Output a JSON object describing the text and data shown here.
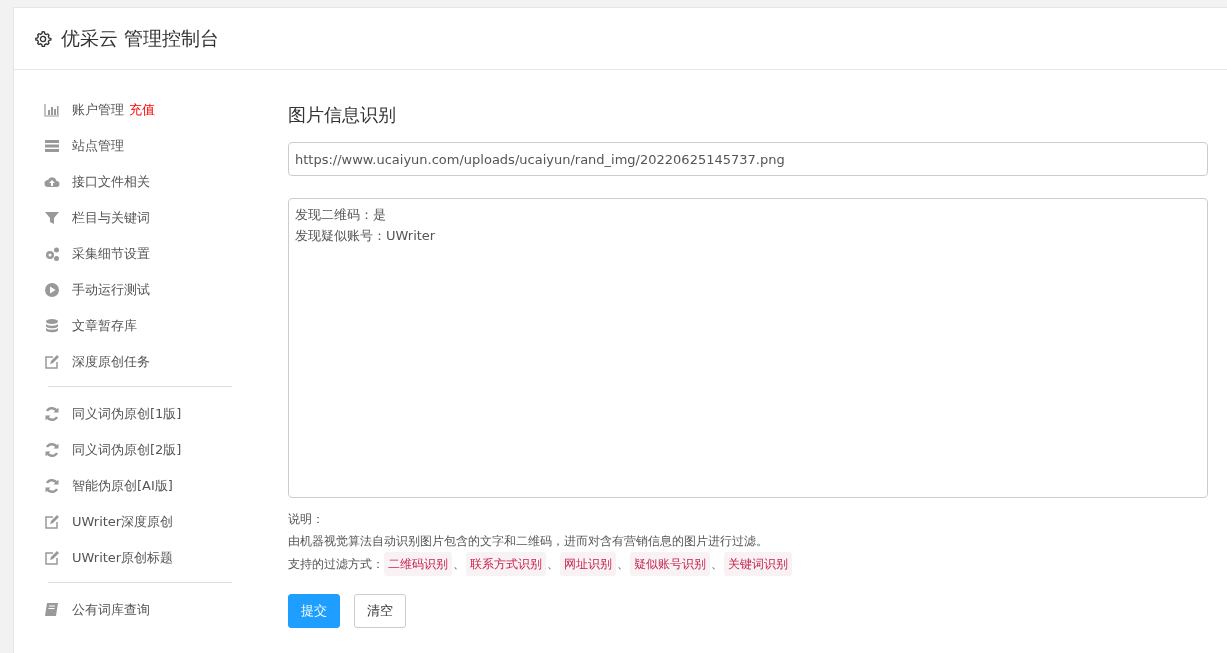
{
  "header": {
    "title": "优采云 管理控制台"
  },
  "sidebar": {
    "groups": [
      {
        "items": [
          {
            "label": "账户管理",
            "badge": "充值"
          },
          {
            "label": "站点管理"
          },
          {
            "label": "接口文件相关"
          },
          {
            "label": "栏目与关键词"
          },
          {
            "label": "采集细节设置"
          },
          {
            "label": "手动运行测试"
          },
          {
            "label": "文章暂存库"
          },
          {
            "label": "深度原创任务"
          }
        ]
      },
      {
        "items": [
          {
            "label": "同义词伪原创[1版]"
          },
          {
            "label": "同义词伪原创[2版]"
          },
          {
            "label": "智能伪原创[AI版]"
          },
          {
            "label": "UWriter深度原创"
          },
          {
            "label": "UWriter原创标题"
          }
        ]
      },
      {
        "items": [
          {
            "label": "公有词库查询"
          }
        ]
      }
    ]
  },
  "main": {
    "title": "图片信息识别",
    "url_field": {
      "value": "https://www.ucaiyun.com/uploads/ucaiyun/rand_img/20220625145737.png"
    },
    "result_box": {
      "lines": [
        "发现二维码：是",
        "发现疑似账号：UWriter"
      ]
    },
    "notes": {
      "heading": "说明：",
      "description": "由机器视觉算法自动识别图片包含的文字和二维码，进而对含有营销信息的图片进行过滤。",
      "methods_label": "支持的过滤方式：",
      "separator": "、",
      "methods": [
        "二维码识别",
        "联系方式识别",
        "网址识别",
        "疑似账号识别",
        "关键词识别"
      ]
    },
    "buttons": [
      {
        "label": "提交",
        "kind": "primary"
      },
      {
        "label": "清空",
        "kind": "default"
      }
    ]
  }
}
